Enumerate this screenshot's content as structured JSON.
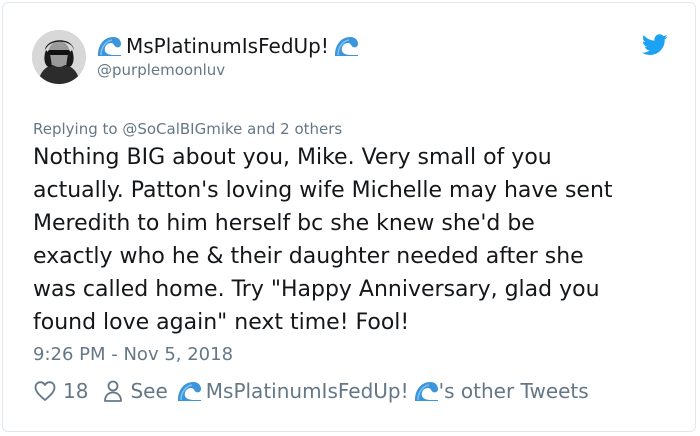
{
  "user": {
    "display_name": "MsPlatinumIsFedUp!",
    "handle": "@purplemoonluv",
    "name_emoji": "water-wave-emoji"
  },
  "reply": {
    "prefix": "Replying to",
    "mention": "@SoCalBIGmike",
    "suffix": "and 2 others"
  },
  "tweet": {
    "lines": [
      "Nothing BIG about you, Mike. Very small of you",
      "actually. Patton's loving wife Michelle may have sent",
      "Meredith to him herself bc she knew she'd be",
      "exactly who he & their daughter needed after she",
      "was called home. Try \"Happy Anniversary, glad you",
      "found love again\" next time! Fool!"
    ],
    "timestamp": "9:26 PM - Nov 5, 2018"
  },
  "actions": {
    "like_count": "18",
    "see_label": "See",
    "see_name": "MsPlatinumIsFedUp!",
    "see_suffix": "'s other Tweets"
  },
  "icons": {
    "brand": "twitter-bird-icon",
    "like": "heart-icon",
    "profile": "person-icon"
  },
  "colors": {
    "twitter_blue": "#1da1f2",
    "text_primary": "#14171a",
    "text_secondary": "#657786",
    "border": "#e1e8ed",
    "wave_blue": "#3b95dc"
  }
}
